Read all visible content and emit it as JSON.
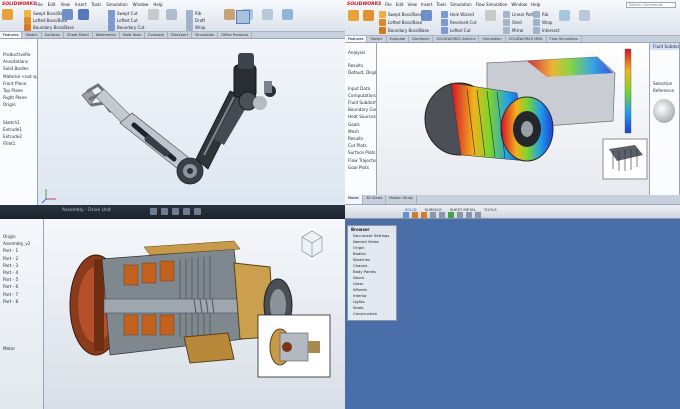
{
  "top_left": {
    "logo": "SOLIDWORKS",
    "menu": [
      "File",
      "Edit",
      "View",
      "Insert",
      "Tools",
      "Simulation",
      "Window",
      "Help"
    ],
    "ribbon_small": [
      "Extruded Boss/Base",
      "Revolved Boss/Base",
      "Swept Boss/Base",
      "Lofted Boss/Base",
      "Boundary Boss/Base"
    ],
    "ribbon_cut": [
      "Extruded Cut",
      "Hole Wizard",
      "Revolved Cut",
      "Swept Cut",
      "Lofted Cut",
      "Boundary Cut"
    ],
    "ribbon_big": [
      "Fillet",
      "Linear Pattern",
      "Rib",
      "Draft",
      "Wrap",
      "Intersect",
      "Reference Geometry",
      "Curves",
      "Instant3D"
    ],
    "tabs": [
      "Features",
      "Sketch",
      "Surfaces",
      "Sheet Metal",
      "Weldments",
      "Mold Tools",
      "Evaluate",
      "DimXpert",
      "Simulation",
      "Office Products"
    ],
    "tree": [
      "",
      "ProductiveRe",
      "",
      "Annotations",
      "Solid Bodies",
      "Material <not specified>",
      "Front Plane",
      "Top Plane",
      "Right Plane",
      "Origin",
      "",
      "",
      "",
      "Sketch1",
      "Extrude1",
      "Extrude2",
      "Fillet1",
      ""
    ]
  },
  "top_right": {
    "menu": [
      "File",
      "Edit",
      "View",
      "Insert",
      "Tools",
      "Simulation",
      "Flow Simulation",
      "Window",
      "Help"
    ],
    "ribbon": [
      "Extruded Boss/Base",
      "Revolved Boss/Base",
      "Swept Boss/Base",
      "Lofted Boss/Base",
      "Boundary Boss/Base",
      "Extruded Cut",
      "Hole Wizard",
      "Revolved Cut",
      "Lofted Cut",
      "Boundary Cut",
      "Fillet",
      "Linear Pattern",
      "Draft",
      "Shell",
      "Rib",
      "Wrap",
      "Intersect",
      "Mirror",
      "Reference Geometry",
      "Curves"
    ],
    "search": "Search Commands",
    "tabs": [
      "Features",
      "Sketch",
      "Evaluate",
      "DimXpert",
      "SOLIDWORKS Add-Ins",
      "Simulation",
      "SOLIDWORKS MBD",
      "Flow Simulation"
    ],
    "tree": [
      "",
      "Analysis",
      "",
      "",
      "Results",
      "Default, Display State",
      "",
      "",
      "Input Data",
      "Computational Domain",
      "Fluid Subdomains",
      "Boundary Conditions",
      "Heat Sources",
      "Goals",
      "Mesh",
      "Results",
      "Cut Plots",
      "Surface Plots",
      "Flow Trajectories",
      "Goal Plots",
      ""
    ],
    "right_panel": [
      "Fluid Subdomain",
      "",
      "",
      "",
      "",
      "",
      "Selection",
      "Reference"
    ],
    "bottom_tabs": [
      "Model",
      "3D Views",
      "Motion Study"
    ],
    "legend_colors": [
      "#d4102a",
      "#f05a18",
      "#f2b21c",
      "#e8e820",
      "#7ed62a",
      "#22c9a4",
      "#21a0e6",
      "#1f3fd8"
    ]
  },
  "bottom_left": {
    "toolbar_title": "Assembly - Drive Unit",
    "tree": [
      "",
      "",
      "Origin",
      "Assembly_v2",
      "Part - 1",
      "Part - 2",
      "Part - 3",
      "Part - 4",
      "Part - 5",
      "Part - 6",
      "Part - 7",
      "Part - 8",
      "",
      "",
      "",
      "",
      "",
      ""
    ],
    "bottom_label": "Motor"
  },
  "bottom_right": {
    "browser_title": "Browser",
    "tree": [
      "",
      "Document Settings",
      "Named Views",
      "Origin",
      "Bodies",
      "Sketches",
      "Chassis",
      "Body Panels",
      "Doors",
      "Glass",
      "Wheels",
      "Interior",
      "Lights",
      "Seats",
      "Construction"
    ],
    "toolbar": [
      "SOLID",
      "SURFACE",
      "SHEET METAL",
      "TOOLS"
    ]
  }
}
